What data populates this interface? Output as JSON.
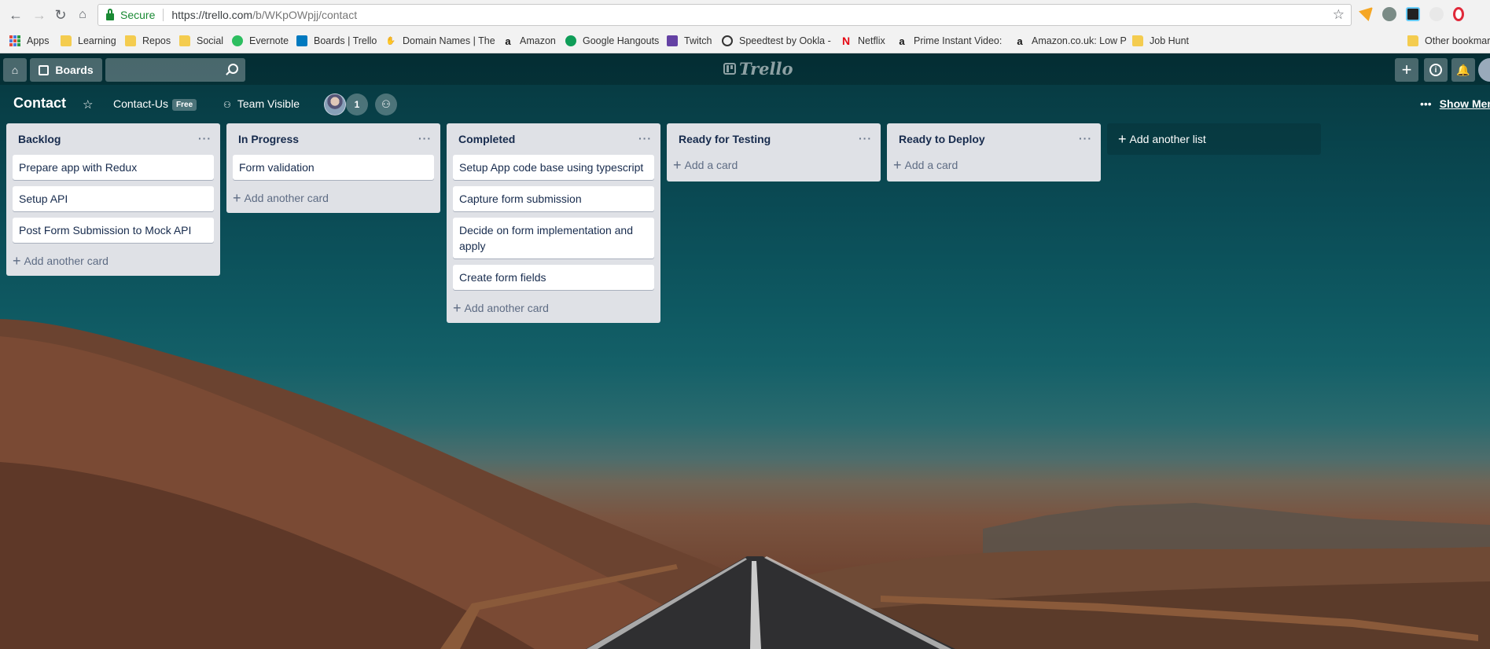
{
  "browser": {
    "secure_label": "Secure",
    "url_host": "https://trello.com",
    "url_path": "/b/WKpOWpjj/contact",
    "bookmarks": [
      {
        "label": "Apps",
        "icon": "apps-grid"
      },
      {
        "label": "Learning",
        "icon": "folder"
      },
      {
        "label": "Repos",
        "icon": "folder"
      },
      {
        "label": "Social",
        "icon": "folder"
      },
      {
        "label": "Evernote",
        "icon": "evernote"
      },
      {
        "label": "Boards | Trello",
        "icon": "trello"
      },
      {
        "label": "Domain Names | The",
        "icon": "domain"
      },
      {
        "label": "Amazon",
        "icon": "amazon"
      },
      {
        "label": "Google Hangouts",
        "icon": "hangouts"
      },
      {
        "label": "Twitch",
        "icon": "twitch"
      },
      {
        "label": "Speedtest by Ookla -",
        "icon": "speedtest"
      },
      {
        "label": "Netflix",
        "icon": "netflix"
      },
      {
        "label": "Prime Instant Video:",
        "icon": "amazon"
      },
      {
        "label": "Amazon.co.uk: Low P",
        "icon": "amazon"
      },
      {
        "label": "Job Hunt",
        "icon": "folder"
      },
      {
        "label": "Other bookmarks",
        "icon": "folder"
      }
    ]
  },
  "header": {
    "boards_label": "Boards",
    "search_value": ""
  },
  "board": {
    "title": "Contact",
    "team": "Contact-Us",
    "team_badge": "Free",
    "visibility": "Team Visible",
    "member_count": "1",
    "show_menu": "Show Menu"
  },
  "lists": [
    {
      "title": "Backlog",
      "cards": [
        "Prepare app with Redux",
        "Setup API",
        "Post Form Submission to Mock API"
      ],
      "add_label": "Add another card"
    },
    {
      "title": "In Progress",
      "cards": [
        "Form validation"
      ],
      "add_label": "Add another card"
    },
    {
      "title": "Completed",
      "cards": [
        "Setup App code base using typescript",
        "Capture form submission",
        "Decide on form implementation and apply",
        "Create form fields"
      ],
      "add_label": "Add another card"
    },
    {
      "title": "Ready for Testing",
      "cards": [],
      "add_label": "Add a card"
    },
    {
      "title": "Ready to Deploy",
      "cards": [],
      "add_label": "Add a card"
    }
  ],
  "add_list_label": "Add another list",
  "colors": {
    "list_bg": "#dfe1e6",
    "card_text": "#172b4d",
    "muted": "#5e6c84"
  }
}
